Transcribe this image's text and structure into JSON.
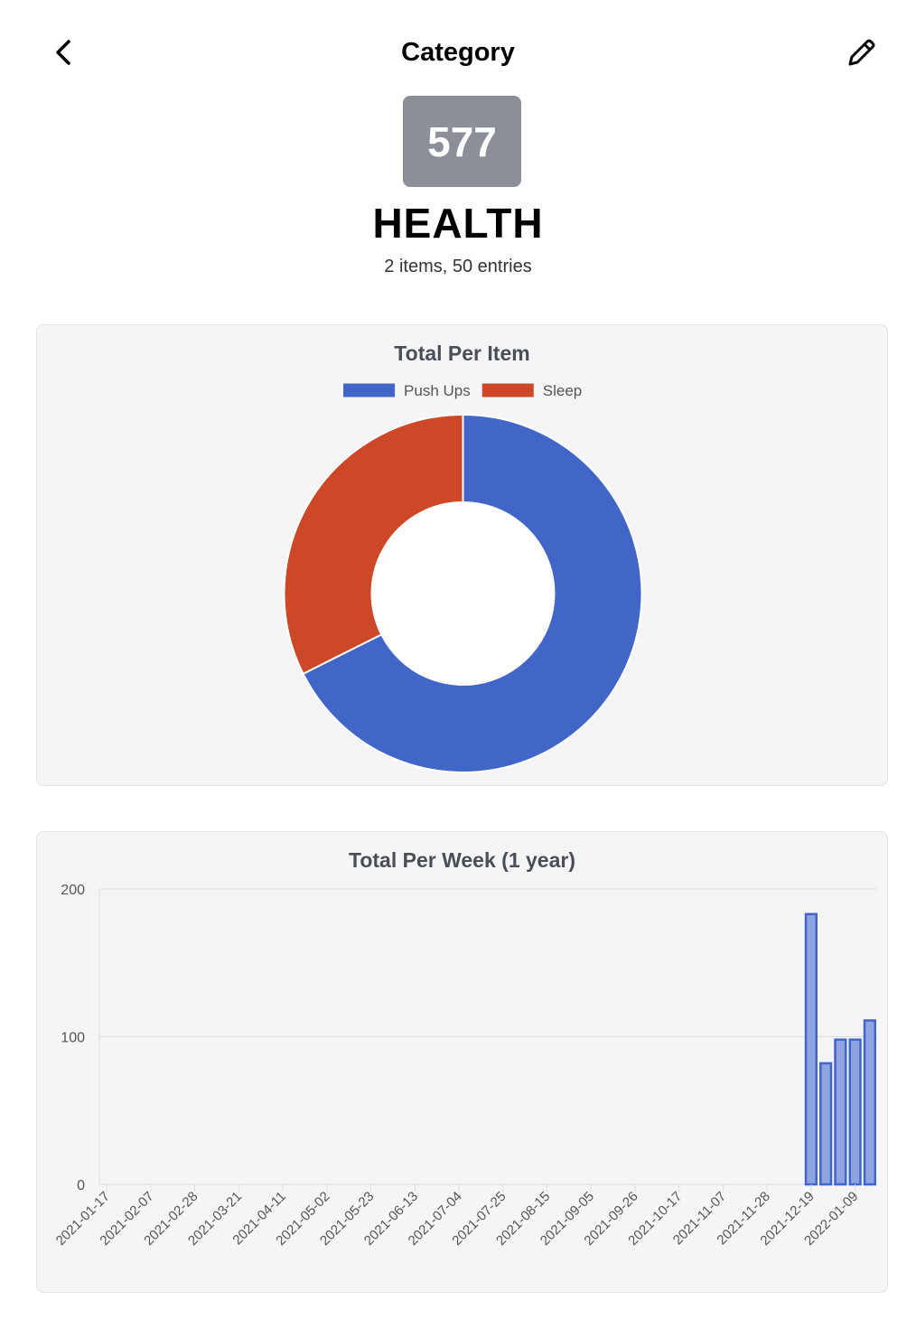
{
  "header": {
    "title": "Category",
    "back_icon": "chevron-left-icon",
    "edit_icon": "pencil-icon"
  },
  "category": {
    "total": "577",
    "name": "HEALTH",
    "summary": "2 items, 50 entries"
  },
  "charts": [
    {
      "title": "Total Per Item"
    },
    {
      "title": "Total Per Week (1 year)"
    }
  ],
  "chart_data": [
    {
      "type": "pie",
      "donut": true,
      "title": "Total Per Item",
      "legend_position": "top",
      "labels": [
        "Push Ups",
        "Sleep"
      ],
      "values": [
        390,
        187
      ],
      "colors": [
        "#4166c7",
        "#cc4827"
      ]
    },
    {
      "type": "bar",
      "title": "Total Per Week (1 year)",
      "ylim": [
        0,
        200
      ],
      "yticks": [
        0,
        100,
        200
      ],
      "grid": true,
      "x_tick_labels": [
        "2021-01-17",
        "2021-02-07",
        "2021-02-28",
        "2021-03-21",
        "2021-04-11",
        "2021-05-02",
        "2021-05-23",
        "2021-06-13",
        "2021-07-04",
        "2021-07-25",
        "2021-08-15",
        "2021-09-05",
        "2021-09-26",
        "2021-10-17",
        "2021-11-07",
        "2021-11-28",
        "2021-12-19",
        "2022-01-09"
      ],
      "x": [
        "2021-01-17",
        "2021-01-24",
        "2021-01-31",
        "2021-02-07",
        "2021-02-14",
        "2021-02-21",
        "2021-02-28",
        "2021-03-07",
        "2021-03-14",
        "2021-03-21",
        "2021-03-28",
        "2021-04-04",
        "2021-04-11",
        "2021-04-18",
        "2021-04-25",
        "2021-05-02",
        "2021-05-09",
        "2021-05-16",
        "2021-05-23",
        "2021-05-30",
        "2021-06-06",
        "2021-06-13",
        "2021-06-20",
        "2021-06-27",
        "2021-07-04",
        "2021-07-11",
        "2021-07-18",
        "2021-07-25",
        "2021-08-01",
        "2021-08-08",
        "2021-08-15",
        "2021-08-22",
        "2021-08-29",
        "2021-09-05",
        "2021-09-12",
        "2021-09-19",
        "2021-09-26",
        "2021-10-03",
        "2021-10-10",
        "2021-10-17",
        "2021-10-24",
        "2021-10-31",
        "2021-11-07",
        "2021-11-14",
        "2021-11-21",
        "2021-11-28",
        "2021-12-05",
        "2021-12-12",
        "2021-12-19",
        "2021-12-26",
        "2022-01-02",
        "2022-01-09",
        "2022-01-16"
      ],
      "values": [
        0,
        0,
        0,
        0,
        0,
        0,
        0,
        0,
        0,
        0,
        0,
        0,
        0,
        0,
        0,
        0,
        0,
        0,
        0,
        0,
        0,
        0,
        0,
        0,
        0,
        0,
        0,
        0,
        0,
        0,
        0,
        0,
        0,
        0,
        0,
        0,
        0,
        0,
        0,
        0,
        0,
        0,
        0,
        0,
        0,
        0,
        0,
        0,
        183,
        82,
        98,
        98,
        111
      ],
      "colors": {
        "bar_fill": "#8fa4e0",
        "bar_stroke": "#4166c7"
      }
    }
  ]
}
